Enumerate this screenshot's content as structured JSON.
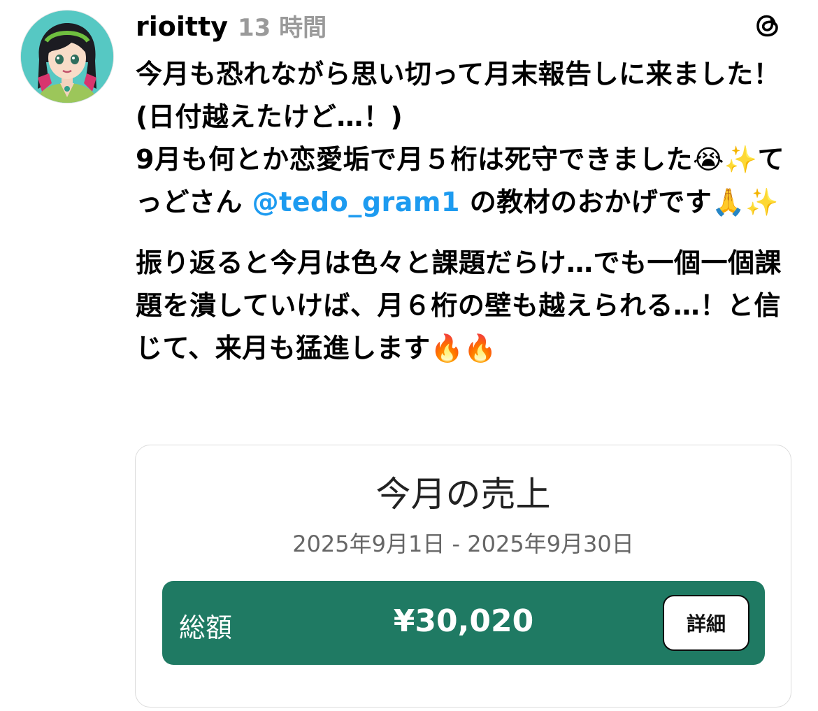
{
  "post": {
    "username": "rioitty",
    "timestamp": "13 時間",
    "paragraph1": {
      "text_before_mention": "今月も恐れながら思い切って月末報告しに来ました！(日付越えたけど…！)\n9月も何とか恋愛垢で月５桁は死守できました😭✨てっどさん ",
      "mention": "@tedo_gram1",
      "text_after_mention": " の教材のおかげです🙏✨"
    },
    "paragraph2": "振り返ると今月は色々と課題だらけ…でも一個一個課題を潰していけば、月６桁の壁も越えられる…！と信じて、来月も猛進します🔥🔥"
  },
  "card": {
    "title": "今月の売上",
    "date_range": "2025年9月1日 - 2025年9月30日",
    "total_label": "総額",
    "total_amount": "¥30,020",
    "details_button": "詳細"
  },
  "colors": {
    "accent_green": "#1f7a63",
    "mention_blue": "#1d9bf0",
    "timestamp_gray": "#9a9a9a"
  },
  "icons": {
    "threads": "threads-logo-icon",
    "avatar": "avatar"
  }
}
